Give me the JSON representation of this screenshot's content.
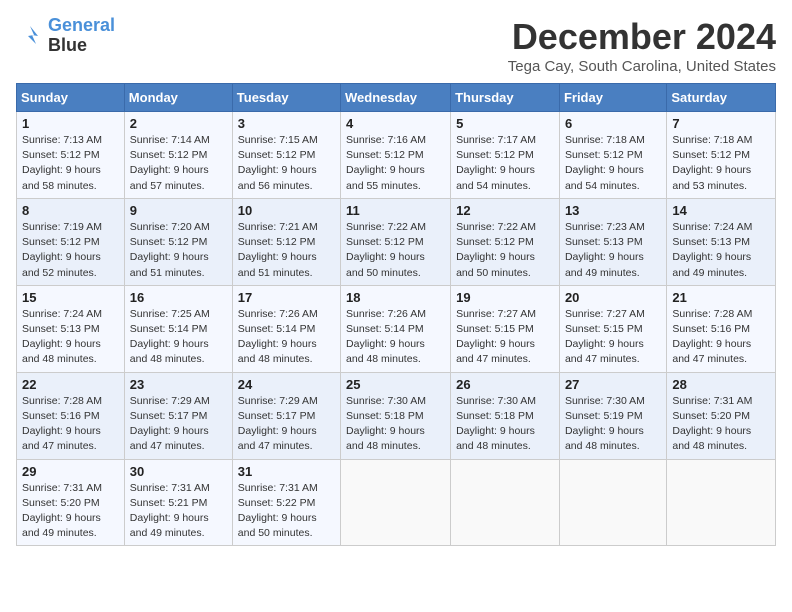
{
  "header": {
    "logo_line1": "General",
    "logo_line2": "Blue",
    "month_title": "December 2024",
    "subtitle": "Tega Cay, South Carolina, United States"
  },
  "days_of_week": [
    "Sunday",
    "Monday",
    "Tuesday",
    "Wednesday",
    "Thursday",
    "Friday",
    "Saturday"
  ],
  "weeks": [
    [
      {
        "day": 1,
        "info": "Sunrise: 7:13 AM\nSunset: 5:12 PM\nDaylight: 9 hours\nand 58 minutes."
      },
      {
        "day": 2,
        "info": "Sunrise: 7:14 AM\nSunset: 5:12 PM\nDaylight: 9 hours\nand 57 minutes."
      },
      {
        "day": 3,
        "info": "Sunrise: 7:15 AM\nSunset: 5:12 PM\nDaylight: 9 hours\nand 56 minutes."
      },
      {
        "day": 4,
        "info": "Sunrise: 7:16 AM\nSunset: 5:12 PM\nDaylight: 9 hours\nand 55 minutes."
      },
      {
        "day": 5,
        "info": "Sunrise: 7:17 AM\nSunset: 5:12 PM\nDaylight: 9 hours\nand 54 minutes."
      },
      {
        "day": 6,
        "info": "Sunrise: 7:18 AM\nSunset: 5:12 PM\nDaylight: 9 hours\nand 54 minutes."
      },
      {
        "day": 7,
        "info": "Sunrise: 7:18 AM\nSunset: 5:12 PM\nDaylight: 9 hours\nand 53 minutes."
      }
    ],
    [
      {
        "day": 8,
        "info": "Sunrise: 7:19 AM\nSunset: 5:12 PM\nDaylight: 9 hours\nand 52 minutes."
      },
      {
        "day": 9,
        "info": "Sunrise: 7:20 AM\nSunset: 5:12 PM\nDaylight: 9 hours\nand 51 minutes."
      },
      {
        "day": 10,
        "info": "Sunrise: 7:21 AM\nSunset: 5:12 PM\nDaylight: 9 hours\nand 51 minutes."
      },
      {
        "day": 11,
        "info": "Sunrise: 7:22 AM\nSunset: 5:12 PM\nDaylight: 9 hours\nand 50 minutes."
      },
      {
        "day": 12,
        "info": "Sunrise: 7:22 AM\nSunset: 5:12 PM\nDaylight: 9 hours\nand 50 minutes."
      },
      {
        "day": 13,
        "info": "Sunrise: 7:23 AM\nSunset: 5:13 PM\nDaylight: 9 hours\nand 49 minutes."
      },
      {
        "day": 14,
        "info": "Sunrise: 7:24 AM\nSunset: 5:13 PM\nDaylight: 9 hours\nand 49 minutes."
      }
    ],
    [
      {
        "day": 15,
        "info": "Sunrise: 7:24 AM\nSunset: 5:13 PM\nDaylight: 9 hours\nand 48 minutes."
      },
      {
        "day": 16,
        "info": "Sunrise: 7:25 AM\nSunset: 5:14 PM\nDaylight: 9 hours\nand 48 minutes."
      },
      {
        "day": 17,
        "info": "Sunrise: 7:26 AM\nSunset: 5:14 PM\nDaylight: 9 hours\nand 48 minutes."
      },
      {
        "day": 18,
        "info": "Sunrise: 7:26 AM\nSunset: 5:14 PM\nDaylight: 9 hours\nand 48 minutes."
      },
      {
        "day": 19,
        "info": "Sunrise: 7:27 AM\nSunset: 5:15 PM\nDaylight: 9 hours\nand 47 minutes."
      },
      {
        "day": 20,
        "info": "Sunrise: 7:27 AM\nSunset: 5:15 PM\nDaylight: 9 hours\nand 47 minutes."
      },
      {
        "day": 21,
        "info": "Sunrise: 7:28 AM\nSunset: 5:16 PM\nDaylight: 9 hours\nand 47 minutes."
      }
    ],
    [
      {
        "day": 22,
        "info": "Sunrise: 7:28 AM\nSunset: 5:16 PM\nDaylight: 9 hours\nand 47 minutes."
      },
      {
        "day": 23,
        "info": "Sunrise: 7:29 AM\nSunset: 5:17 PM\nDaylight: 9 hours\nand 47 minutes."
      },
      {
        "day": 24,
        "info": "Sunrise: 7:29 AM\nSunset: 5:17 PM\nDaylight: 9 hours\nand 47 minutes."
      },
      {
        "day": 25,
        "info": "Sunrise: 7:30 AM\nSunset: 5:18 PM\nDaylight: 9 hours\nand 48 minutes."
      },
      {
        "day": 26,
        "info": "Sunrise: 7:30 AM\nSunset: 5:18 PM\nDaylight: 9 hours\nand 48 minutes."
      },
      {
        "day": 27,
        "info": "Sunrise: 7:30 AM\nSunset: 5:19 PM\nDaylight: 9 hours\nand 48 minutes."
      },
      {
        "day": 28,
        "info": "Sunrise: 7:31 AM\nSunset: 5:20 PM\nDaylight: 9 hours\nand 48 minutes."
      }
    ],
    [
      {
        "day": 29,
        "info": "Sunrise: 7:31 AM\nSunset: 5:20 PM\nDaylight: 9 hours\nand 49 minutes."
      },
      {
        "day": 30,
        "info": "Sunrise: 7:31 AM\nSunset: 5:21 PM\nDaylight: 9 hours\nand 49 minutes."
      },
      {
        "day": 31,
        "info": "Sunrise: 7:31 AM\nSunset: 5:22 PM\nDaylight: 9 hours\nand 50 minutes."
      },
      null,
      null,
      null,
      null
    ]
  ]
}
